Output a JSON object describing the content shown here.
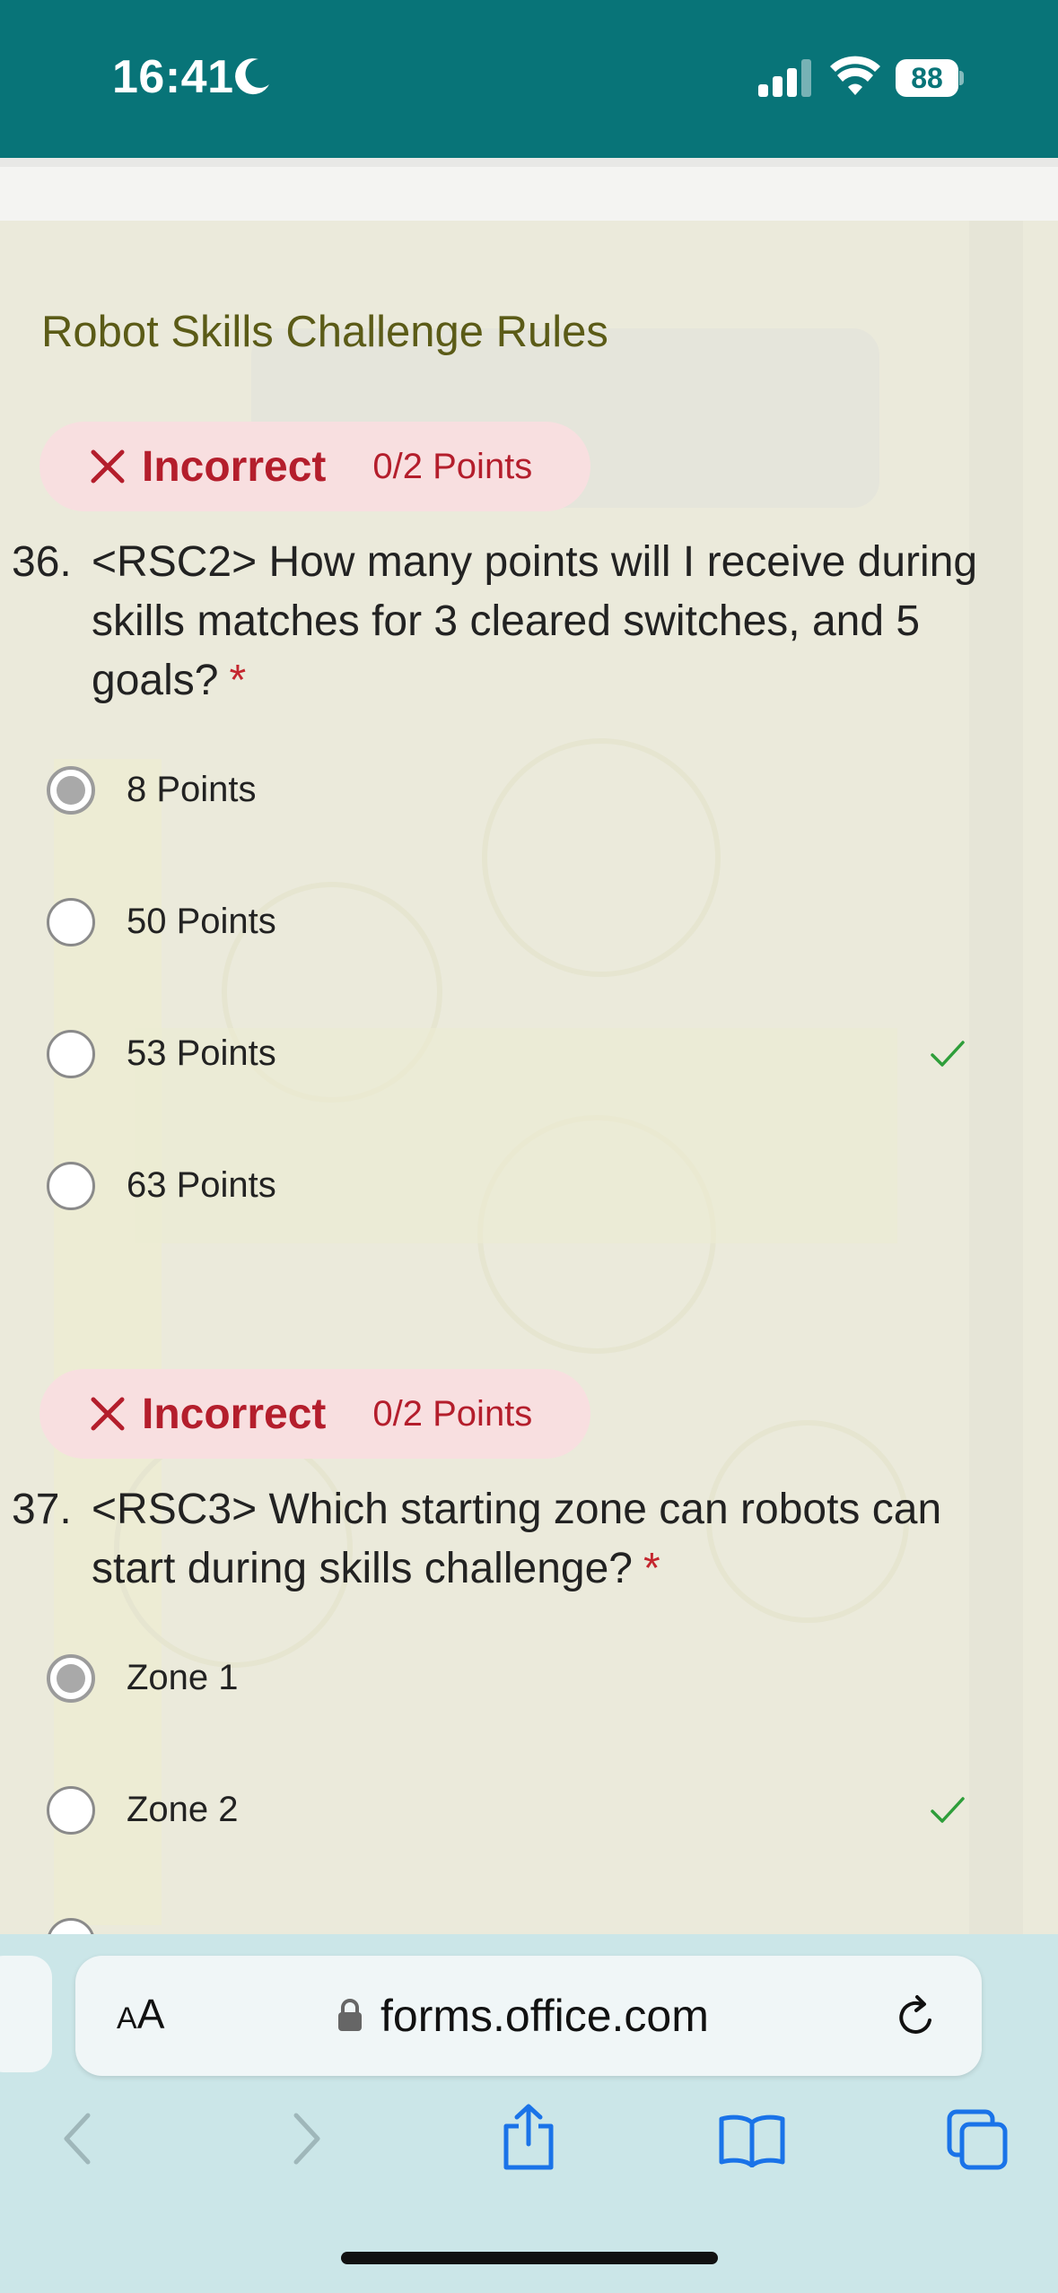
{
  "status_bar": {
    "time": "16:41",
    "battery": "88",
    "icons": [
      "moon-icon",
      "signal-icon",
      "wifi-icon",
      "battery-icon"
    ]
  },
  "section": {
    "title": "Robot Skills Challenge Rules"
  },
  "questions": [
    {
      "result": {
        "label": "Incorrect",
        "points": "0/2 Points"
      },
      "number": "36.",
      "text": "<RSC2> How many points will I receive during skills matches for 3 cleared switches, and 5 goals?",
      "required_mark": "*",
      "options": [
        {
          "label": "8 Points",
          "selected": true,
          "correct": false
        },
        {
          "label": "50 Points",
          "selected": false,
          "correct": false
        },
        {
          "label": "53 Points",
          "selected": false,
          "correct": true
        },
        {
          "label": "63 Points",
          "selected": false,
          "correct": false
        }
      ]
    },
    {
      "result": {
        "label": "Incorrect",
        "points": "0/2 Points"
      },
      "number": "37.",
      "text": "<RSC3> Which starting zone can robots can start during skills challenge?",
      "required_mark": "*",
      "options": [
        {
          "label": "Zone 1",
          "selected": true,
          "correct": false
        },
        {
          "label": "Zone 2",
          "selected": false,
          "correct": true
        }
      ]
    }
  ],
  "browser": {
    "aa_label_small": "A",
    "aa_label_large": "A",
    "url": "forms.office.com",
    "toolbar_icons": [
      "back-icon",
      "forward-icon",
      "share-icon",
      "bookmarks-icon",
      "tabs-icon"
    ]
  },
  "colors": {
    "status_bar": "#087478",
    "incorrect": "#b41e2c",
    "incorrect_bg": "#f8dfe0",
    "correct_check": "#2e9e3a",
    "section_title": "#5b5b17",
    "browser_bg": "#cbe6e8",
    "toolbar_icon": "#1a73e8"
  }
}
